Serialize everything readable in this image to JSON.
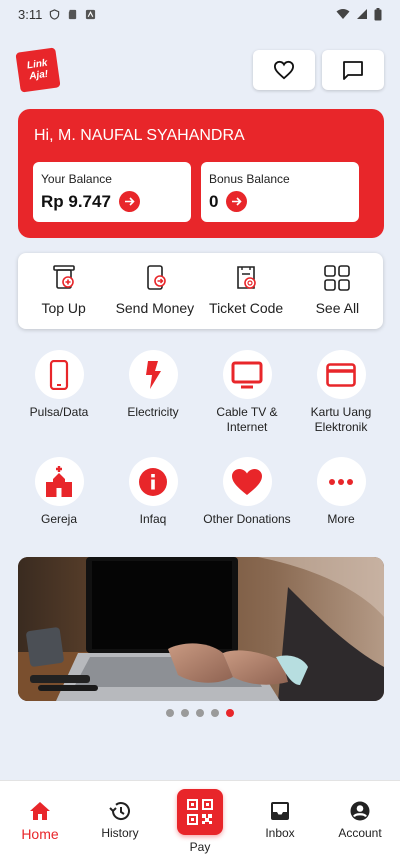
{
  "status_bar": {
    "time": "3:11"
  },
  "brand": {
    "logo_line1": "Link",
    "logo_line2": "Aja!",
    "accent": "#e8262a"
  },
  "balance": {
    "greeting": "Hi, M. NAUFAL SYAHANDRA",
    "your_balance_label": "Your Balance",
    "your_balance_value": "Rp 9.747",
    "bonus_balance_label": "Bonus Balance",
    "bonus_balance_value": "0"
  },
  "quick_actions": [
    {
      "label": "Top Up",
      "icon": "top-up-icon"
    },
    {
      "label": "Send Money",
      "icon": "send-money-icon"
    },
    {
      "label": "Ticket Code",
      "icon": "ticket-code-icon"
    },
    {
      "label": "See All",
      "icon": "grid-icon"
    }
  ],
  "services": [
    {
      "label": "Pulsa/Data",
      "icon": "phone-icon"
    },
    {
      "label": "Electricity",
      "icon": "lightning-icon"
    },
    {
      "label": "Cable TV & Internet",
      "icon": "tv-icon"
    },
    {
      "label": "Kartu Uang Elektronik",
      "icon": "card-icon"
    },
    {
      "label": "Gereja",
      "icon": "church-icon"
    },
    {
      "label": "Infaq",
      "icon": "info-icon"
    },
    {
      "label": "Other Donations",
      "icon": "heart-icon"
    },
    {
      "label": "More",
      "icon": "more-icon"
    }
  ],
  "carousel": {
    "total": 5,
    "active_index": 4
  },
  "bottom_nav": [
    {
      "label": "Home",
      "icon": "home-icon",
      "active": true
    },
    {
      "label": "History",
      "icon": "history-icon",
      "active": false
    },
    {
      "label": "Pay",
      "icon": "qr-icon",
      "active": false
    },
    {
      "label": "Inbox",
      "icon": "inbox-icon",
      "active": false
    },
    {
      "label": "Account",
      "icon": "account-icon",
      "active": false
    }
  ]
}
